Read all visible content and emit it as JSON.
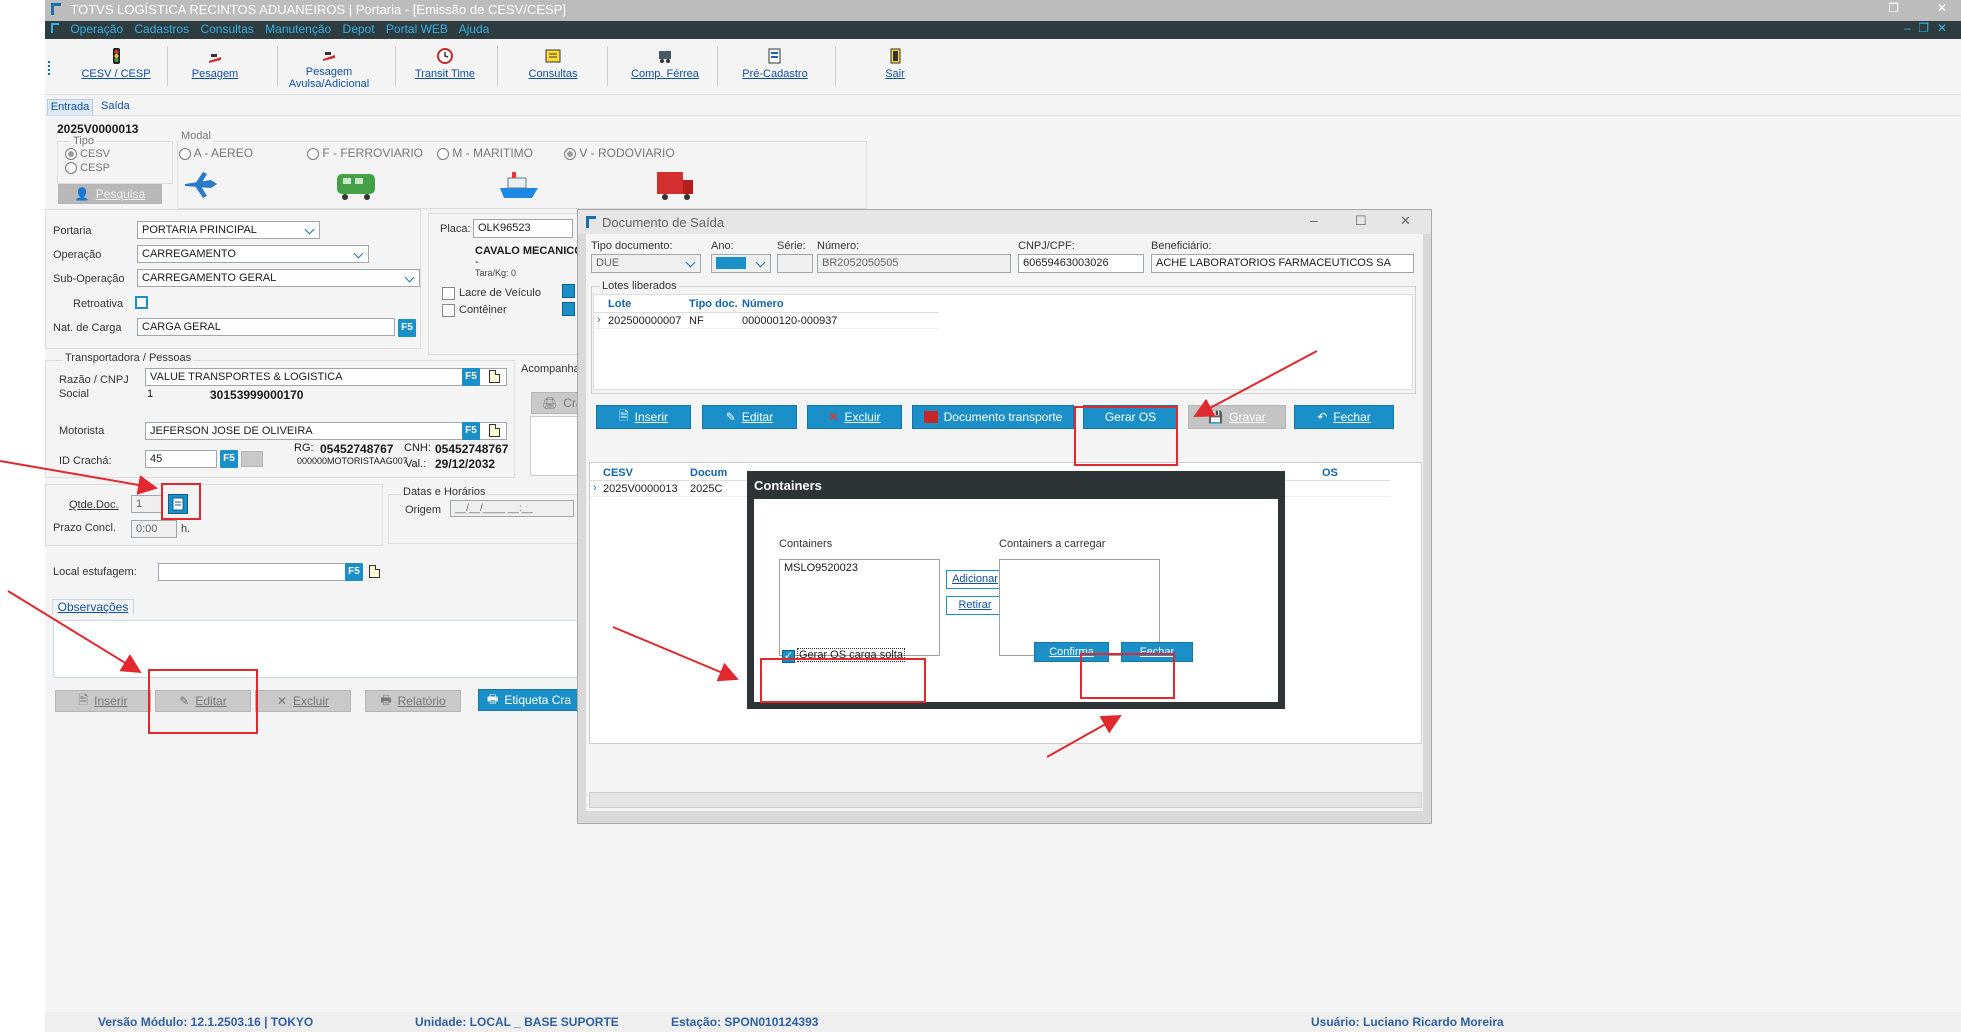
{
  "window": {
    "title": "TOTVS LOGÍSTICA RECINTOS ADUANEIROS | Portaria - [Emissão de CESV/CESP]"
  },
  "menu": [
    "Operação",
    "Cadastros",
    "Consultas",
    "Manutenção",
    "Depot",
    "Portal WEB",
    "Ajuda"
  ],
  "toolbar": [
    {
      "label": "CESV / CESP",
      "icon": "traffic-light-icon"
    },
    {
      "label": "Pesagem",
      "icon": "scale-icon"
    },
    {
      "label": "Pesagem Avulsa/Adicional",
      "icon": "scale-extra-icon"
    },
    {
      "label": "Transit Time",
      "icon": "clock-icon"
    },
    {
      "label": "Consultas",
      "icon": "search-list-icon"
    },
    {
      "label": "Comp. Férrea",
      "icon": "train-wagon-icon"
    },
    {
      "label": "Pré-Cadastro",
      "icon": "register-icon"
    },
    {
      "label": "Sair",
      "icon": "exit-door-icon"
    }
  ],
  "tabs": {
    "entrada": "Entrada",
    "saida": "Saída"
  },
  "form": {
    "cesv_number": "2025V0000013",
    "tipo_label": "Tipo",
    "tipo_cesv": "CESV",
    "tipo_cesp": "CESP",
    "pesquisa": "Pesquisa",
    "modal_label": "Modal",
    "modal_aereo": "A - AEREO",
    "modal_ferroviario": "F - FERROVIARIO",
    "modal_maritimo": "M - MARITIMO",
    "modal_rodoviario": "V - RODOVIARIO",
    "portaria_label": "Portaria",
    "portaria_value": "PORTARIA PRINCIPAL",
    "operacao_label": "Operação",
    "operacao_value": "CARREGAMENTO",
    "suboperacao_label": "Sub-Operação",
    "suboperacao_value": "CARREGAMENTO GERAL",
    "retroativa_label": "Retroativa",
    "natcarga_label": "Nat. de Carga",
    "natcarga_value": "CARGA GERAL",
    "placa_label": "Placa:",
    "placa_value": "OLK96523",
    "veiculo_value": "CAVALO MECANICO",
    "veiculo_dash": "-",
    "tara": "Tara/Kg: 0",
    "lacre": "Lacre de Veículo",
    "conteiner": "Contêiner",
    "acompanha_label": "Acompanha",
    "cra_label": "Cra",
    "transp_group": "Transportadora / Pessoas",
    "razao_label": "Razão / CNPJ",
    "social_label": "Social",
    "razao_value": "VALUE TRANSPORTES & LOGISTICA",
    "razao_num": "1",
    "cnpj_value": "30153999000170",
    "motorista_label": "Motorista",
    "motorista_value": "JEFERSON JOSE DE OLIVEIRA",
    "idcracha_label": "ID Crachá:",
    "idcracha_value": "45",
    "rg_label": "RG:",
    "rg_value": "05452748767",
    "cnh_label": "CNH:",
    "cnh_value": "05452748767",
    "motorista_code": "000000MOTORISTAAG007",
    "val_label": "Val.:",
    "val_value": "29/12/2032",
    "qtdedoc_label": "Qtde.Doc.",
    "qtdedoc_value": "1",
    "prazo_label": "Prazo Concl.",
    "prazo_value": "0:00",
    "prazo_unit": "h.",
    "datas_label": "Datas e Horários",
    "origem_label": "Origem",
    "origem_value": "__/__/____ __:__",
    "local_label": "Local estufagem:",
    "obs_tab": "Observações",
    "f5": "F5"
  },
  "bottom_buttons": {
    "inserir": "Inserir",
    "editar": "Editar",
    "excluir": "Excluir",
    "relatorio": "Relatório",
    "etiqueta": "Etiqueta Cra"
  },
  "doc_saida": {
    "title": "Documento de Saída",
    "tipo_label": "Tipo documento:",
    "tipo_value": "DUE",
    "ano_label": "Ano:",
    "serie_label": "Série:",
    "numero_label": "Número:",
    "numero_value": "BR2052050505",
    "cnpj_label": "CNPJ/CPF:",
    "cnpj_value": "60659463003026",
    "benef_label": "Beneficiário:",
    "benef_value": "ACHE LABORATORIOS FARMACEUTICOS SA",
    "lotes_label": "Lotes liberados",
    "lotes_headers": [
      "Lote",
      "Tipo doc.",
      "Número"
    ],
    "lotes_rows": [
      [
        "202500000007",
        "NF",
        "000000120-000937"
      ]
    ],
    "buttons": {
      "inserir": "Inserir",
      "editar": "Editar",
      "excluir": "Excluir",
      "doc_transporte": "Documento transporte",
      "gerar_os": "Gerar OS",
      "gravar": "Gravar",
      "fechar": "Fechar"
    },
    "lower_headers": [
      "CESV",
      "Docum",
      "OS"
    ],
    "lower_row": [
      "2025V0000013",
      "2025C"
    ]
  },
  "containers_dialog": {
    "title": "Containers",
    "left_label": "Containers",
    "right_label": "Containers a carregar",
    "items": [
      "MSLO9520023"
    ],
    "adicionar": "Adicionar",
    "retirar": "Retirar",
    "gerar_os_check": "Gerar OS carga solta",
    "confirma": "Confirma",
    "fechar": "Fechar"
  },
  "status": {
    "versao": "Versão Módulo:  12.1.2503.16  |  TOKYO",
    "unidade": "Unidade: LOCAL _ BASE SUPORTE",
    "estacao": "Estação: SPON010124393",
    "usuario": "Usuário: Luciano Ricardo Moreira"
  },
  "colors": {
    "accent": "#1b8fc7",
    "menu_bg": "#2e3b3f",
    "highlight": "#e0282e"
  }
}
